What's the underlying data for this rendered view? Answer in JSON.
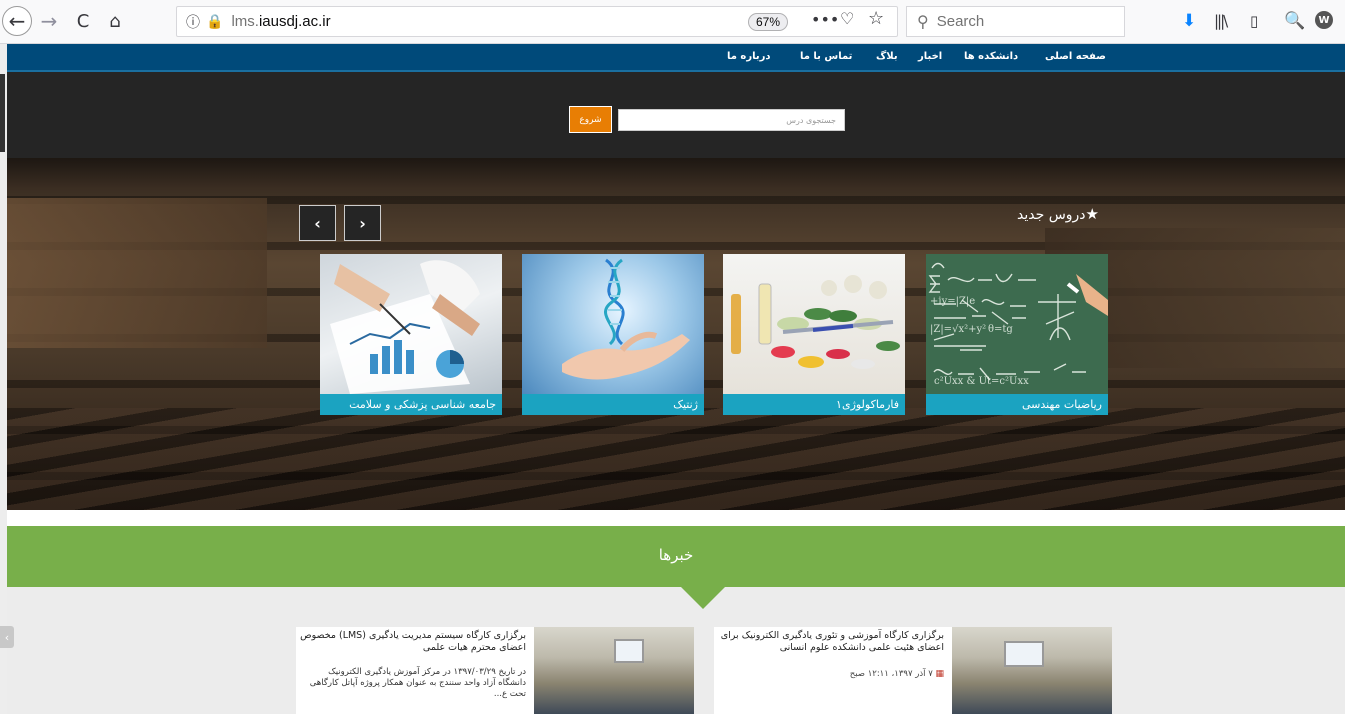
{
  "browser": {
    "url_host_prefix": "lms.",
    "url_host_main": "iausdj.ac.ir",
    "zoom": "67%",
    "search_placeholder": "Search",
    "icons": {
      "back": "←",
      "forward": "→",
      "reload": "C",
      "home": "⌂",
      "info": "ⓘ",
      "insecure": "🔒",
      "more": "•••",
      "pocket": "♡",
      "star": "☆",
      "search": "⚲",
      "download": "⬇",
      "library": "|||\\",
      "sidebar": "▯",
      "ext1": "🔍",
      "ext2": "W"
    }
  },
  "nav": {
    "items": [
      "صفحه اصلی",
      "دانشکده ها",
      "اخبار",
      "بلاگ",
      "تماس با ما",
      "درباره ما"
    ]
  },
  "search": {
    "placeholder": "جستجوی درس",
    "button": "شروع"
  },
  "courses": {
    "title": "دروس جدید",
    "star": "★",
    "prev": "‹",
    "next": "›",
    "items": [
      {
        "label": "ریاضیات مهندسی"
      },
      {
        "label": "فارماکولوژی۱"
      },
      {
        "label": "ژنتیک"
      },
      {
        "label": "جامعه شناسی پزشکی و سلامت"
      }
    ]
  },
  "news": {
    "title": "خبرها",
    "items": [
      {
        "headline": "برگزاری کارگاه آموزشی و تئوری یادگیری الکترونیک برای اعضای هئیت علمی دانشکده علوم انسانی",
        "date": "۷ آذر ۱۳۹۷، ۱۲:۱۱ صبح"
      },
      {
        "headline": "برگزاری کارگاه سیستم مدیریت یادگیری (LMS) مخصوص اعضای محترم هیات علمی",
        "excerpt": "در تاریخ ۱۳۹۷/۰۳/۲۹ در مرکز آموزش یادگیری الکترونیک دانشگاه آزاد واحد سنندج به عنوان همکار پروژه آپاتل کارگاهی تحت ع..."
      }
    ]
  }
}
